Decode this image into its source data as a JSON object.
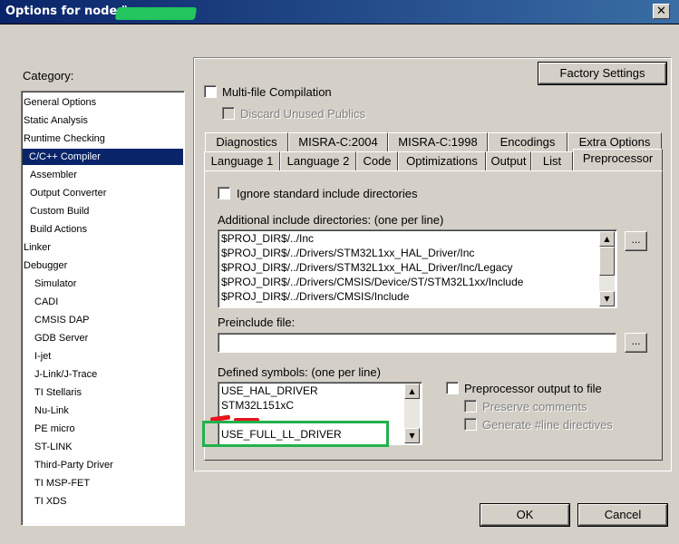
{
  "window": {
    "title": "Options for node \"",
    "close_glyph": "✕"
  },
  "category": {
    "label": "Category:",
    "items": [
      "General Options",
      "Static Analysis",
      "Runtime Checking",
      "C/C++ Compiler",
      "Assembler",
      "Output Converter",
      "Custom Build",
      "Build Actions",
      "Linker",
      "Debugger",
      "Simulator",
      "CADI",
      "CMSIS DAP",
      "GDB Server",
      "I-jet",
      "J-Link/J-Trace",
      "TI Stellaris",
      "Nu-Link",
      "PE micro",
      "ST-LINK",
      "Third-Party Driver",
      "TI MSP-FET",
      "TI XDS"
    ],
    "selected": "C/C++ Compiler"
  },
  "options": {
    "factory_settings": "Factory Settings",
    "multifile": "Multi-file Compilation",
    "discard_unused": "Discard Unused Publics"
  },
  "tabs": {
    "row1": [
      "Diagnostics",
      "MISRA-C:2004",
      "MISRA-C:1998",
      "Encodings",
      "Extra Options"
    ],
    "row2": [
      "Language 1",
      "Language 2",
      "Code",
      "Optimizations",
      "Output",
      "List",
      "Preprocessor"
    ],
    "active": "Preprocessor"
  },
  "preprocessor": {
    "ignore_std": "Ignore standard include directories",
    "include_label": "Additional include directories: (one per line)",
    "include_dirs": [
      "$PROJ_DIR$/../Inc",
      "$PROJ_DIR$/../Drivers/STM32L1xx_HAL_Driver/Inc",
      "$PROJ_DIR$/../Drivers/STM32L1xx_HAL_Driver/Inc/Legacy",
      "$PROJ_DIR$/../Drivers/CMSIS/Device/ST/STM32L1xx/Include",
      "$PROJ_DIR$/../Drivers/CMSIS/Include"
    ],
    "browse": "...",
    "preinclude_label": "Preinclude file:",
    "preinclude_value": "",
    "defined_label": "Defined symbols: (one per line)",
    "defined_symbols": [
      "USE_HAL_DRIVER",
      "STM32L151xC",
      "",
      "USE_FULL_LL_DRIVER"
    ],
    "preproc_output": "Preprocessor output to file",
    "preserve_comments": "Preserve comments",
    "generate_line": "Generate #line directives"
  },
  "buttons": {
    "ok": "OK",
    "cancel": "Cancel"
  },
  "colors": {
    "highlight_box": "#22b14c",
    "red_mark": "#e8141c",
    "selection": "#0a246a"
  }
}
